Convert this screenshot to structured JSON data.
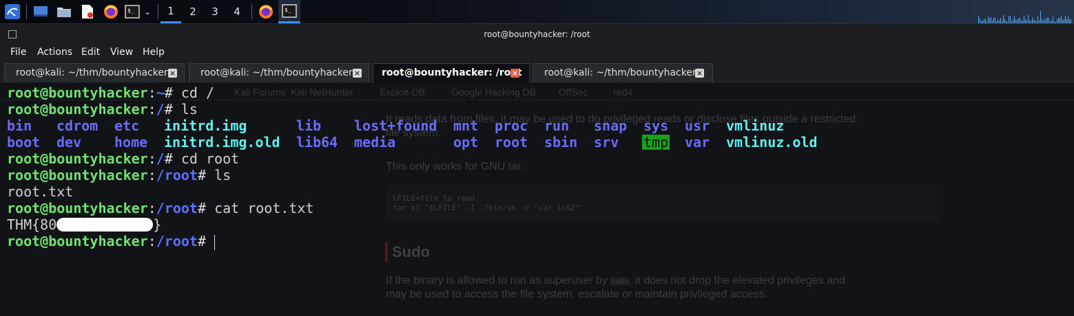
{
  "panel": {
    "workspaces": [
      "1",
      "2",
      "3",
      "4"
    ],
    "active_workspace": "1",
    "icons": [
      "kali-menu-icon",
      "show-desktop-icon",
      "file-manager-icon",
      "text-editor-icon",
      "firefox-icon",
      "terminal-icon",
      "chevron-down-icon",
      "firefox-icon",
      "terminal-icon"
    ]
  },
  "window": {
    "title": "root@bountyhacker: /root",
    "menu": [
      "File",
      "Actions",
      "Edit",
      "View",
      "Help"
    ]
  },
  "tabs": [
    {
      "label": "root@kali: ~/thm/bountyhacker",
      "active": false
    },
    {
      "label": "root@kali: ~/thm/bountyhacker",
      "active": false
    },
    {
      "label": "root@bountyhacker: /root",
      "active": true
    },
    {
      "label": "root@kali: ~/thm/bountyhacker",
      "active": false
    }
  ],
  "terminal": {
    "user_host": "root@bountyhacker",
    "lines": [
      {
        "path": "~",
        "cmd": "cd /"
      },
      {
        "path": "/",
        "cmd": "ls"
      },
      {
        "path": "/",
        "cmd": "cd root"
      },
      {
        "path": "/root",
        "cmd": "ls"
      },
      {
        "path": "/root",
        "cmd": "cat root.txt"
      },
      {
        "path": "/root",
        "cmd": ""
      }
    ],
    "ls_row1": [
      "bin",
      "cdrom",
      "etc",
      "initrd.img",
      "lib",
      "lost+found",
      "mnt",
      "proc",
      "run",
      "snap",
      "sys",
      "usr",
      "vmlinuz"
    ],
    "ls_row2": [
      "boot",
      "dev",
      "home",
      "initrd.img.old",
      "lib64",
      "media",
      "opt",
      "root",
      "sbin",
      "srv",
      "tmp",
      "var",
      "vmlinuz.old"
    ],
    "file_listing": "root.txt",
    "flag_prefix": "THM{80",
    "flag_suffix": "}",
    "colors": {
      "user": "#6fe36f",
      "path": "#5f6fff",
      "dir": "#6b6bff",
      "link": "#5ff0f0",
      "tmp_bg": "#16a116"
    }
  },
  "background_page": {
    "bookmarks": [
      "Kali Forums",
      "Kali NetHunter",
      "Exploit-DB",
      "Google Hacking DB",
      "OffSec",
      "red4"
    ],
    "para1": "It reads data from files, it may be used to do privileged reads or disclose files outside a restricted",
    "para1b": "file system.",
    "para2": "This only works for GNU tar.",
    "code1": "LFILE=file_to_read",
    "code2": "tar xf \"$LFILE\" -I '/bin/sh -c \"cat 1>&2\"'",
    "heading": "Sudo",
    "para3a": "If the binary is allowed to run as superuser by",
    "para3code": "sudo",
    "para3b": ", it does not drop the elevated privileges and",
    "para3c": "may be used to access the file system, escalate or maintain privileged access."
  }
}
